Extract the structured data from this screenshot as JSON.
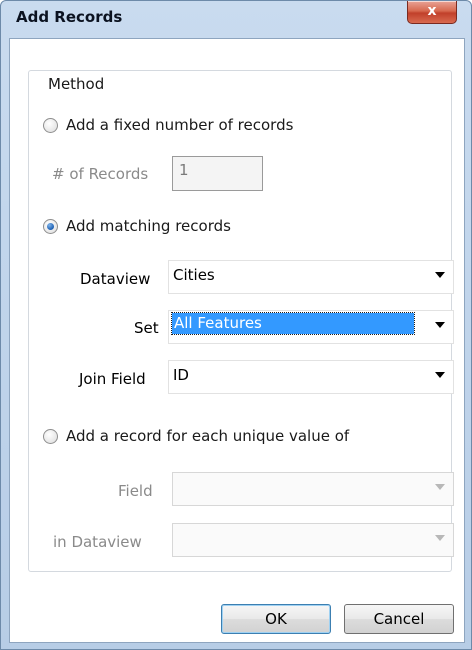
{
  "window": {
    "title": "Add Records",
    "close_glyph": "x"
  },
  "group": {
    "legend": "Method"
  },
  "options": {
    "fixed": {
      "label": "Add a fixed number of records",
      "checked": false
    },
    "matching": {
      "label": "Add matching records",
      "checked": true
    },
    "unique": {
      "label": "Add a record for each unique value of",
      "checked": false
    }
  },
  "fixed_fields": {
    "records_label": "# of Records",
    "records_value": "1"
  },
  "matching_fields": {
    "dataview_label": "Dataview",
    "dataview_value": "Cities",
    "set_label": "Set",
    "set_value": "All Features",
    "join_label": "Join Field",
    "join_value": "ID"
  },
  "unique_fields": {
    "field_label": "Field",
    "field_value": "",
    "dataview_label": "in Dataview",
    "dataview_value": ""
  },
  "buttons": {
    "ok": "OK",
    "cancel": "Cancel"
  }
}
